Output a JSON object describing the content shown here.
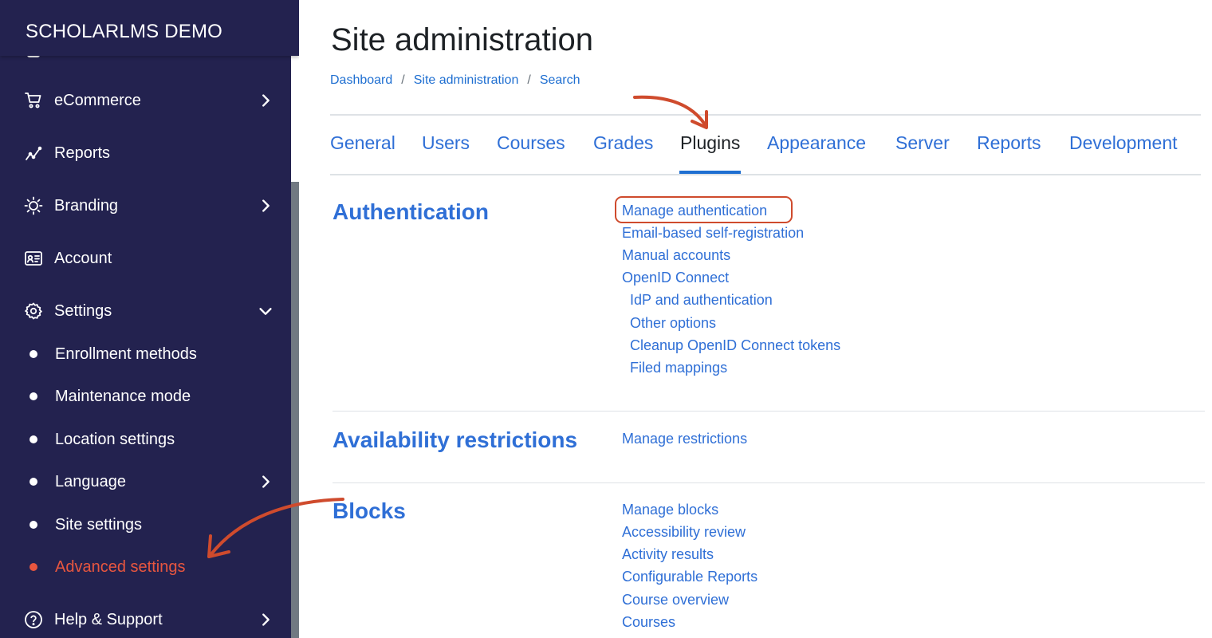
{
  "sidebar": {
    "brand": "SCHOLARLMS DEMO",
    "items": [
      {
        "label": "eCommerce",
        "icon": "cart-icon",
        "has_chevron": true
      },
      {
        "label": "Reports",
        "icon": "chart-line-icon",
        "has_chevron": false
      },
      {
        "label": "Branding",
        "icon": "sun-icon",
        "has_chevron": true
      },
      {
        "label": "Account",
        "icon": "id-card-icon",
        "has_chevron": false
      },
      {
        "label": "Settings",
        "icon": "gear-icon",
        "has_chevron": true,
        "expanded": true
      }
    ],
    "settings_subitems": [
      {
        "label": "Enrollment methods"
      },
      {
        "label": "Maintenance mode"
      },
      {
        "label": "Location settings"
      },
      {
        "label": "Language",
        "has_chevron": true
      },
      {
        "label": "Site settings"
      },
      {
        "label": "Advanced settings",
        "active": true
      }
    ],
    "help": {
      "label": "Help & Support",
      "icon": "question-circle-icon"
    }
  },
  "main": {
    "title": "Site administration",
    "breadcrumb": [
      "Dashboard",
      "Site administration",
      "Search"
    ],
    "tabs": [
      "General",
      "Users",
      "Courses",
      "Grades",
      "Plugins",
      "Appearance",
      "Server",
      "Reports",
      "Development"
    ],
    "active_tab": "Plugins",
    "sections": [
      {
        "title": "Authentication",
        "links": [
          "Manage authentication",
          "Email-based self-registration",
          "Manual accounts",
          "OpenID Connect"
        ],
        "sublinks": [
          "IdP and authentication",
          "Other options",
          "Cleanup OpenID Connect tokens",
          "Filed mappings"
        ]
      },
      {
        "title": "Availability restrictions",
        "links": [
          "Manage restrictions"
        ]
      },
      {
        "title": "Blocks",
        "links": [
          "Manage blocks",
          "Accessibility review",
          "Activity results",
          "Configurable Reports",
          "Course overview",
          "Courses"
        ]
      }
    ]
  },
  "colors": {
    "sidebar_bg": "#23224f",
    "link": "#2f6fd6",
    "accent_active": "#e8563f",
    "annotation": "#cf4b2d"
  }
}
